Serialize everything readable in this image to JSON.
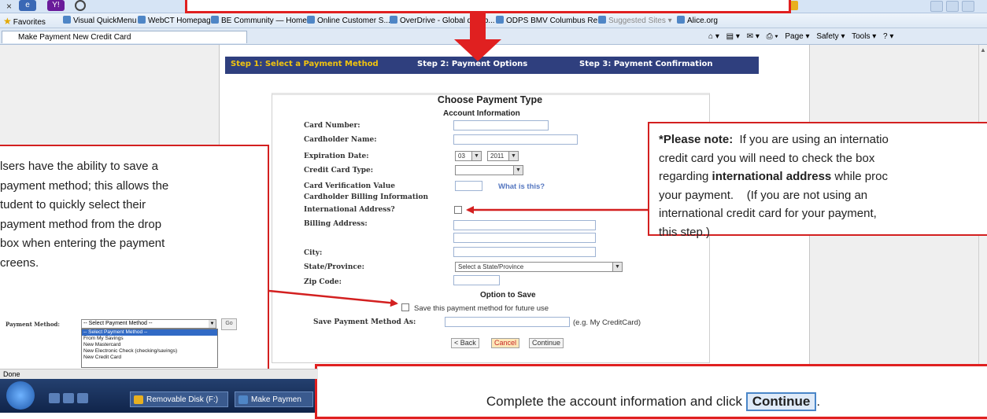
{
  "browser": {
    "favorites_label": "Favorites",
    "favorites": [
      "Visual QuickMenu",
      "WebCT Homepage",
      "BE Community — Home",
      "Online Customer S...",
      "OverDrive - Global distrib...",
      "ODPS BMV Columbus Re...",
      "Suggested Sites ▾",
      "Alice.org"
    ],
    "tab_title": "Make Payment New Credit Card",
    "commands": [
      "Page ▾",
      "Safety ▾",
      "Tools ▾"
    ],
    "status": "Done"
  },
  "steps": {
    "step1": "Step 1: Select a Payment Method",
    "step2": "Step 2: Payment Options",
    "step3": "Step 3: Payment Confirmation",
    "active_color": "#f1c40f"
  },
  "form": {
    "title": "Choose Payment Type",
    "account_section": "Account Information",
    "card_number_label": "Card Number:",
    "cardholder_name_label": "Cardholder Name:",
    "expiration_label": "Expiration Date:",
    "exp_month": "03",
    "exp_year": "2011",
    "card_type_label": "Credit Card Type:",
    "cvv_label": "Card Verification Value",
    "what_is_this": "What is this?",
    "billing_section": "Cardholder Billing Information",
    "intl_label": "International Address?",
    "billing_address_label": "Billing Address:",
    "city_label": "City:",
    "state_label": "State/Province:",
    "state_placeholder": "Select a State/Province",
    "zip_label": "Zip Code:",
    "save_section": "Option to Save",
    "save_checkbox_text": "Save this payment method for future use",
    "save_as_label": "Save Payment Method As:",
    "save_as_hint": "(e.g. My CreditCard)",
    "back_button": "< Back",
    "cancel_button": "Cancel",
    "continue_button": "Continue"
  },
  "annotations": {
    "left_callout": "lsers have the ability to save a\npayment method; this allows the\ntudent to quickly select their\npayment method from the drop\nbox when entering the payment\ncreens.",
    "right_callout_note": "*Please note:",
    "right_callout_line1_rest": "  If you are using an internatio",
    "right_callout_line2": "credit card you will need to check the box",
    "right_callout_line3_a": "regarding ",
    "right_callout_line3_bold": "international address",
    "right_callout_line3_b": " while proc",
    "right_callout_line4": "your payment.    (If you are not using an",
    "right_callout_line5": "international credit card for your payment,",
    "right_callout_line6": "this step.)",
    "bottom_text": "Complete the account information and click ",
    "bottom_button": "Continue",
    "bottom_period": "."
  },
  "payment_method_sample": {
    "label": "Payment Method:",
    "selected": "-- Select Payment Method --",
    "go": "Go",
    "options": [
      "-- Select Payment Method --",
      "From My Savings",
      "New Mastercard",
      "New Electronic Check (checking/savings)",
      "New Credit Card"
    ]
  },
  "taskbar": {
    "tasks": [
      "Removable Disk (F:)",
      "Make Paymen"
    ]
  }
}
